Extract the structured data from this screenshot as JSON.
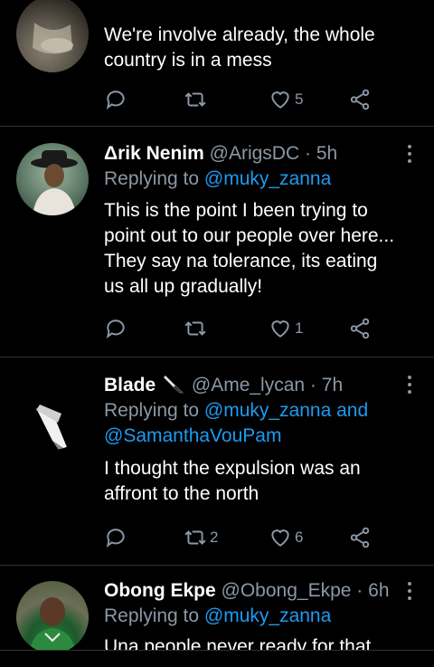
{
  "tweets": [
    {
      "name": "",
      "handle": "",
      "time": "",
      "replying_prefix": "",
      "replying_to": "",
      "text": "We're involve already, the whole country is in a mess",
      "counts": {
        "reply": "",
        "retweet": "",
        "like": "5"
      }
    },
    {
      "name": "Δrik Nenim",
      "handle": "@ArigsDC",
      "time": "5h",
      "replying_prefix": "Replying to",
      "replying_to": "@muky_zanna",
      "text": "This is the point I been trying to point out to our people over here... They say na tolerance, its eating us all up gradually!",
      "counts": {
        "reply": "",
        "retweet": "",
        "like": "1"
      }
    },
    {
      "name": "Blade",
      "name_emoji": "knife",
      "handle": "@Ame_lycan",
      "time": "7h",
      "replying_prefix": "Replying to",
      "replying_to": "@muky_zanna and",
      "replying_to_2": "@SamanthaVouPam",
      "text": "I thought  the expulsion  was an affront  to the north",
      "counts": {
        "reply": "",
        "retweet": "2",
        "like": "6"
      }
    },
    {
      "name": "Obong Ekpe",
      "handle": "@Obong_Ekpe",
      "time": "6h",
      "replying_prefix": "Replying to",
      "replying_to": "@muky_zanna",
      "text": "Una people never ready for that",
      "counts": {
        "reply": "",
        "retweet": "",
        "like": ""
      }
    }
  ],
  "separator": "·",
  "icons": [
    "reply-icon",
    "retweet-icon",
    "like-icon",
    "share-icon",
    "more-icon"
  ],
  "colors": {
    "background": "#000000",
    "text": "#ffffff",
    "muted": "#8b98a5",
    "link": "#1d9bf0",
    "divider": "#2f3336"
  }
}
